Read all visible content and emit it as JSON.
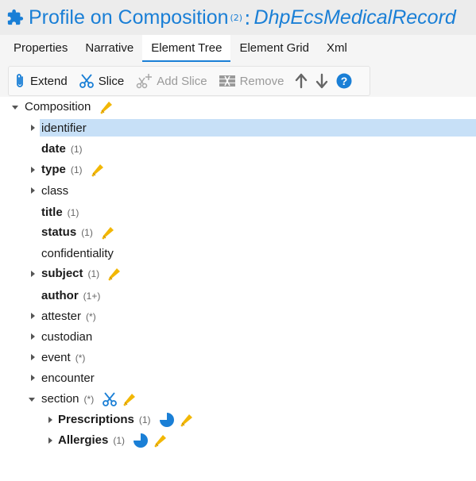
{
  "header": {
    "title": "Profile on Composition",
    "superscript": "(2)",
    "colon": ":",
    "profile_name": "DhpEcsMedicalRecord"
  },
  "tabs": [
    {
      "label": "Properties",
      "active": false
    },
    {
      "label": "Narrative",
      "active": false
    },
    {
      "label": "Element Tree",
      "active": true
    },
    {
      "label": "Element Grid",
      "active": false
    },
    {
      "label": "Xml",
      "active": false
    }
  ],
  "toolbar": {
    "extend_label": "Extend",
    "slice_label": "Slice",
    "add_slice_label": "Add Slice",
    "remove_label": "Remove"
  },
  "tree": {
    "root": {
      "label": "Composition"
    },
    "rows": [
      {
        "label": "identifier",
        "card": "",
        "bold": false,
        "expandable": true,
        "selected": true
      },
      {
        "label": "date",
        "card": "(1)",
        "bold": true,
        "expandable": false
      },
      {
        "label": "type",
        "card": "(1)",
        "bold": true,
        "expandable": true,
        "pen": true
      },
      {
        "label": "class",
        "card": "",
        "bold": false,
        "expandable": true
      },
      {
        "label": "title",
        "card": "(1)",
        "bold": true,
        "expandable": false
      },
      {
        "label": "status",
        "card": "(1)",
        "bold": true,
        "expandable": false,
        "pen": true
      },
      {
        "label": "confidentiality",
        "card": "",
        "bold": false,
        "expandable": false
      },
      {
        "label": "subject",
        "card": "(1)",
        "bold": true,
        "expandable": true,
        "pen": true
      },
      {
        "label": "author",
        "card": "(1+)",
        "bold": true,
        "expandable": false
      },
      {
        "label": "attester",
        "card": "(*)",
        "bold": false,
        "expandable": true
      },
      {
        "label": "custodian",
        "card": "",
        "bold": false,
        "expandable": true
      },
      {
        "label": "event",
        "card": "(*)",
        "bold": false,
        "expandable": true
      },
      {
        "label": "encounter",
        "card": "",
        "bold": false,
        "expandable": true
      },
      {
        "label": "section",
        "card": "(*)",
        "bold": false,
        "expanded": true,
        "scissors": true,
        "pen": true
      }
    ],
    "children": [
      {
        "label": "Prescriptions",
        "card": "(1)",
        "bold": true,
        "pie": true,
        "pen": true
      },
      {
        "label": "Allergies",
        "card": "(1)",
        "bold": true,
        "pie": true,
        "pen": true
      }
    ]
  },
  "colors": {
    "accent": "#1a7fd6",
    "selection": "#c7e0f7",
    "pen": "#f2b705"
  }
}
